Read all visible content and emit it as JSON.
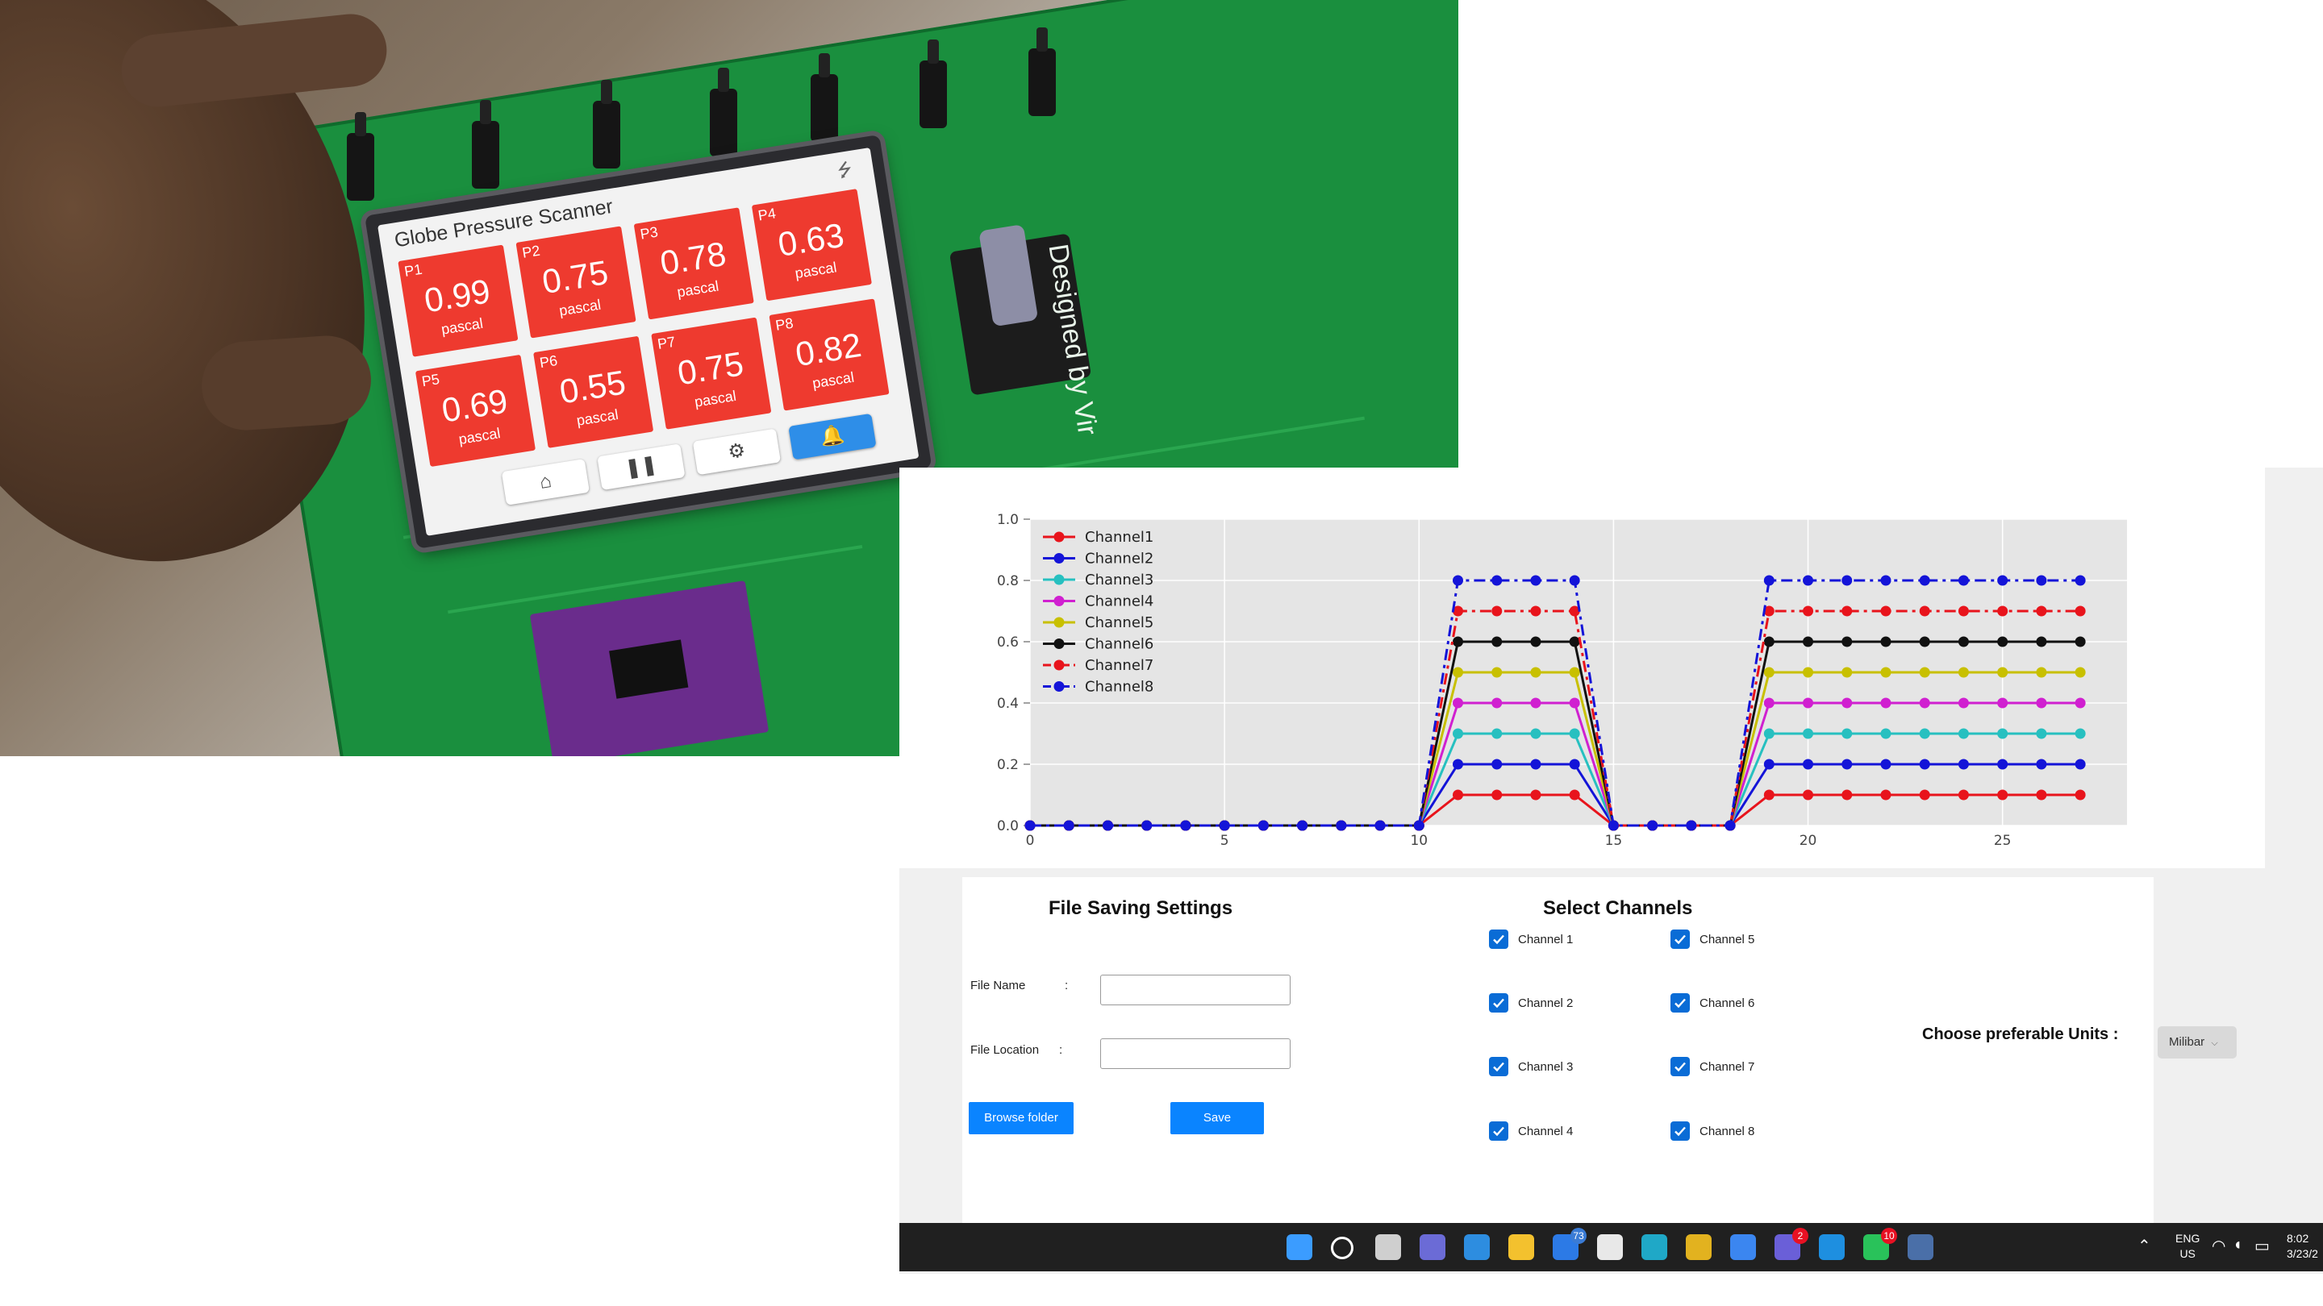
{
  "photo": {
    "lcd": {
      "title": "Globe Pressure Scanner",
      "usb_icon": "usb-icon",
      "tiles": [
        {
          "label": "P1",
          "value": "0.99",
          "unit": "pascal"
        },
        {
          "label": "P2",
          "value": "0.75",
          "unit": "pascal"
        },
        {
          "label": "P3",
          "value": "0.78",
          "unit": "pascal"
        },
        {
          "label": "P4",
          "value": "0.63",
          "unit": "pascal"
        },
        {
          "label": "P5",
          "value": "0.69",
          "unit": "pascal"
        },
        {
          "label": "P6",
          "value": "0.55",
          "unit": "pascal"
        },
        {
          "label": "P7",
          "value": "0.75",
          "unit": "pascal"
        },
        {
          "label": "P8",
          "value": "0.82",
          "unit": "pascal"
        }
      ],
      "buttons": [
        {
          "icon": "home-icon",
          "glyph": "⌂"
        },
        {
          "icon": "pause-icon",
          "glyph": "❚❚"
        },
        {
          "icon": "gear-icon",
          "glyph": "⚙"
        },
        {
          "icon": "bell-icon",
          "glyph": "🔔"
        }
      ]
    },
    "board_text": "Designed by Vir"
  },
  "chart_data": {
    "type": "line",
    "x": [
      0,
      1,
      2,
      3,
      4,
      5,
      6,
      7,
      8,
      9,
      10,
      11,
      12,
      13,
      14,
      15,
      16,
      17,
      18,
      19,
      20,
      21,
      22,
      23,
      24,
      25,
      26,
      27
    ],
    "xlim": [
      0,
      28.2
    ],
    "ylim": [
      0,
      1.0
    ],
    "xticks": [
      "0",
      "5",
      "10",
      "15",
      "20",
      "25"
    ],
    "yticks": [
      "0.0",
      "0.2",
      "0.4",
      "0.6",
      "0.8",
      "1.0"
    ],
    "grid": true,
    "legend_position": "top-left",
    "series": [
      {
        "name": "Channel1",
        "color": "#e8141c",
        "level": 0.1
      },
      {
        "name": "Channel2",
        "color": "#1414d8",
        "level": 0.2
      },
      {
        "name": "Channel3",
        "color": "#27c0c0",
        "level": 0.3
      },
      {
        "name": "Channel4",
        "color": "#d020d0",
        "level": 0.4
      },
      {
        "name": "Channel5",
        "color": "#c8c000",
        "level": 0.5
      },
      {
        "name": "Channel6",
        "color": "#111111",
        "level": 0.6
      },
      {
        "name": "Channel7",
        "color": "#e8141c",
        "level": 0.7
      },
      {
        "name": "Channel8",
        "color": "#1414d8",
        "level": 0.8
      }
    ],
    "active_x": [
      11,
      12,
      13,
      14,
      19,
      20,
      21,
      22,
      23,
      24,
      25,
      26,
      27
    ]
  },
  "settings": {
    "file_header": "File Saving Settings",
    "file_name_label": "File Name",
    "file_name_colon": ":",
    "file_name_value": "",
    "file_location_label": "File Location",
    "file_location_colon": ":",
    "file_location_value": "",
    "browse_label": "Browse folder",
    "save_label": "Save",
    "channels_header": "Select Channels",
    "channels": [
      {
        "label": "Channel 1",
        "checked": true
      },
      {
        "label": "Channel 2",
        "checked": true
      },
      {
        "label": "Channel 3",
        "checked": true
      },
      {
        "label": "Channel 4",
        "checked": true
      },
      {
        "label": "Channel 5",
        "checked": true
      },
      {
        "label": "Channel 6",
        "checked": true
      },
      {
        "label": "Channel 7",
        "checked": true
      },
      {
        "label": "Channel 8",
        "checked": true
      }
    ],
    "units_label": "Choose preferable Units :",
    "units_value": "Milibar"
  },
  "taskbar": {
    "icons": [
      {
        "name": "start-icon",
        "color": "#3b9cff"
      },
      {
        "name": "search-icon",
        "color": "#ffffff"
      },
      {
        "name": "task-view-icon",
        "color": "#cfcfcf"
      },
      {
        "name": "chat-icon",
        "color": "#6b6bd6"
      },
      {
        "name": "mail-icon",
        "color": "#2d8de0"
      },
      {
        "name": "file-explorer-icon",
        "color": "#f3c12e"
      },
      {
        "name": "notes-icon",
        "color": "#2c7ae6",
        "badge": "73"
      },
      {
        "name": "store-icon",
        "color": "#e8e8e8"
      },
      {
        "name": "edge-icon",
        "color": "#1fa8c7"
      },
      {
        "name": "chrome-icon",
        "color": "#e2b21f"
      },
      {
        "name": "todo-icon",
        "color": "#3b86f0"
      },
      {
        "name": "teams-icon",
        "color": "#6a5fd8",
        "badge": "2"
      },
      {
        "name": "vscode-icon",
        "color": "#1e8fe0"
      },
      {
        "name": "whatsapp-icon",
        "color": "#29c25a",
        "badge": "10"
      },
      {
        "name": "python-app-icon",
        "color": "#4a6fa8"
      }
    ],
    "tray": {
      "lang_top": "ENG",
      "lang_bottom": "US",
      "time": "8:02",
      "date": "3/23/2"
    }
  }
}
